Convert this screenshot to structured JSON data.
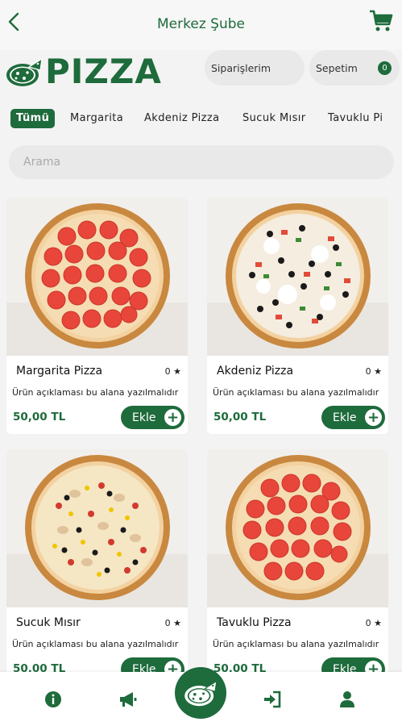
{
  "topbar": {
    "title": "Merkez Şube"
  },
  "brand": {
    "logo_text": "PIZZA"
  },
  "header": {
    "orders_label": "Siparişlerim",
    "cart_label": "Sepetim",
    "cart_count": "0"
  },
  "tabs": [
    {
      "label": "Tümü",
      "active": true
    },
    {
      "label": "Margarita"
    },
    {
      "label": "Akdeniz Pizza"
    },
    {
      "label": "Sucuk Mısır"
    },
    {
      "label": "Tavuklu Pi"
    }
  ],
  "search": {
    "placeholder": "Arama"
  },
  "products": [
    {
      "name": "Margarita Pizza",
      "rating": "0 ★",
      "description": "Ürün açıklaması bu alana yazılmalıdır",
      "price": "50,00 TL",
      "add_label": "Ekle"
    },
    {
      "name": "Akdeniz Pizza",
      "rating": "0 ★",
      "description": "Ürün açıklaması bu alana yazılmalıdır",
      "price": "50,00 TL",
      "add_label": "Ekle"
    },
    {
      "name": "Sucuk Mısır",
      "rating": "0 ★",
      "description": "Ürün açıklaması bu alana yazılmalıdır",
      "price": "50,00 TL",
      "add_label": "Ekle"
    },
    {
      "name": "Tavuklu Pizza",
      "rating": "0 ★",
      "description": "Ürün açıklaması bu alana yazılmalıdır",
      "price": "50,00 TL",
      "add_label": "Ekle"
    }
  ],
  "bottom_nav": [
    "info-icon",
    "megaphone-icon",
    "pizza-home-icon",
    "login-icon",
    "user-icon"
  ],
  "colors": {
    "brand_green": "#1e6b3c",
    "background": "#f3f3f3"
  }
}
